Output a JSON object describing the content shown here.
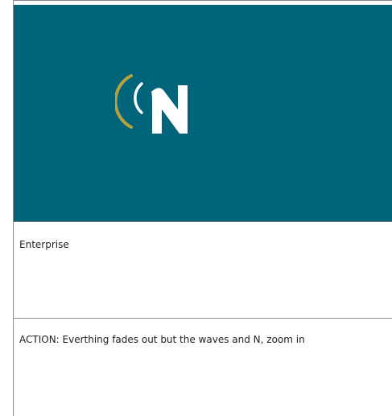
{
  "frame": {
    "background_color": "#00657b",
    "logo": {
      "icon": "signal-waves-n-logo-icon",
      "wave_color": "#b9a03a",
      "letter_color": "#ffffff"
    }
  },
  "rows": {
    "scene_label": "Enterprise",
    "action_text": "ACTION: Everthing fades out but the waves and N, zoom in"
  }
}
